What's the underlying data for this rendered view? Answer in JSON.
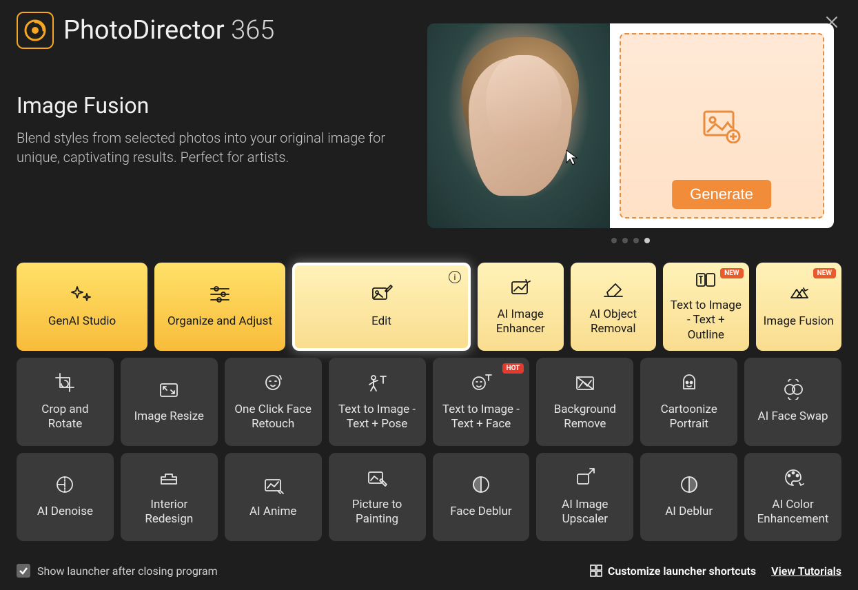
{
  "app": {
    "name": "PhotoDirector",
    "edition": "365"
  },
  "hero": {
    "title": "Image Fusion",
    "description": "Blend styles from selected photos into your original image for unique, captivating results. Perfect for artists.",
    "generate_label": "Generate",
    "pager_active_index": 3,
    "pager_count": 4
  },
  "tiles_row1": [
    {
      "id": "genai-studio",
      "label": "GenAI Studio",
      "style": "primary",
      "icon": "sparkles"
    },
    {
      "id": "organize-adjust",
      "label": "Organize and Adjust",
      "style": "primary",
      "icon": "sliders"
    },
    {
      "id": "edit",
      "label": "Edit",
      "style": "light",
      "icon": "edit-image",
      "info": true,
      "selected": true
    },
    {
      "id": "ai-image-enhancer",
      "label": "AI Image Enhancer",
      "style": "light",
      "icon": "enhance"
    },
    {
      "id": "ai-object-removal",
      "label": "AI Object Removal",
      "style": "light",
      "icon": "eraser"
    },
    {
      "id": "text-to-image-outline",
      "label": "Text to Image - Text + Outline",
      "style": "light",
      "icon": "tti-outline",
      "badge": "NEW"
    },
    {
      "id": "image-fusion",
      "label": "Image Fusion",
      "style": "light",
      "icon": "fusion",
      "badge": "NEW"
    }
  ],
  "tiles_row2": [
    {
      "id": "crop-rotate",
      "label": "Crop and Rotate",
      "icon": "crop"
    },
    {
      "id": "image-resize",
      "label": "Image Resize",
      "icon": "resize"
    },
    {
      "id": "face-retouch",
      "label": "One Click Face Retouch",
      "icon": "face-retouch"
    },
    {
      "id": "tti-pose",
      "label": "Text to Image - Text + Pose",
      "icon": "pose"
    },
    {
      "id": "tti-face",
      "label": "Text to Image - Text + Face",
      "icon": "face-tti",
      "badge": "HOT"
    },
    {
      "id": "bg-remove",
      "label": "Background Remove",
      "icon": "bg-remove"
    },
    {
      "id": "cartoonize",
      "label": "Cartoonize Portrait",
      "icon": "cartoon"
    },
    {
      "id": "face-swap",
      "label": "AI Face Swap",
      "icon": "face-swap"
    }
  ],
  "tiles_row3": [
    {
      "id": "ai-denoise",
      "label": "AI Denoise",
      "icon": "denoise"
    },
    {
      "id": "interior-redesign",
      "label": "Interior Redesign",
      "icon": "interior"
    },
    {
      "id": "ai-anime",
      "label": "AI Anime",
      "icon": "anime"
    },
    {
      "id": "picture-painting",
      "label": "Picture to Painting",
      "icon": "painting"
    },
    {
      "id": "face-deblur",
      "label": "Face Deblur",
      "icon": "deblur"
    },
    {
      "id": "ai-upscaler",
      "label": "AI Image Upscaler",
      "icon": "upscale"
    },
    {
      "id": "ai-deblur",
      "label": "AI Deblur",
      "icon": "deblur2"
    },
    {
      "id": "ai-color",
      "label": "AI Color Enhancement",
      "icon": "color"
    }
  ],
  "footer": {
    "show_launcher_label": "Show launcher after closing program",
    "show_launcher_checked": true,
    "customize_label": "Customize launcher shortcuts",
    "tutorials_label": "View Tutorials"
  }
}
